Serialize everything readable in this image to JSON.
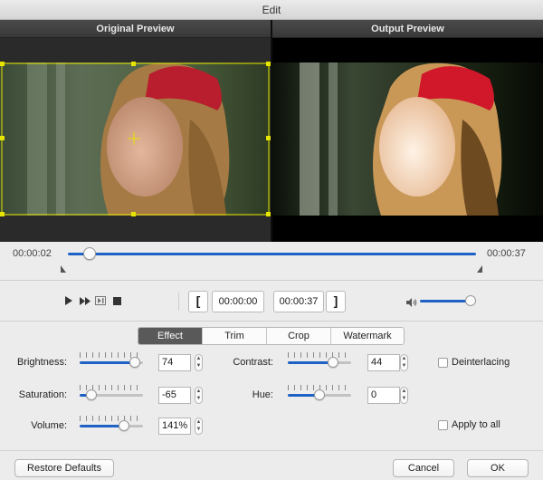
{
  "window": {
    "title": "Edit"
  },
  "preview": {
    "original_title": "Original Preview",
    "output_title": "Output Preview"
  },
  "timeline": {
    "current_time": "00:00:02",
    "end_time": "00:00:37",
    "position_fraction": 0.054
  },
  "playback": {
    "start_time": "00:00:00",
    "end_time": "00:00:37",
    "set_start_label": "[",
    "set_end_label": "]",
    "volume_fraction": 0.9
  },
  "tabs": [
    {
      "label": "Effect",
      "active": true
    },
    {
      "label": "Trim",
      "active": false
    },
    {
      "label": "Crop",
      "active": false
    },
    {
      "label": "Watermark",
      "active": false
    }
  ],
  "effect": {
    "brightness": {
      "label": "Brightness:",
      "value": "74",
      "fraction": 0.87
    },
    "contrast": {
      "label": "Contrast:",
      "value": "44",
      "fraction": 0.72
    },
    "saturation": {
      "label": "Saturation:",
      "value": "-65",
      "fraction": 0.18
    },
    "hue": {
      "label": "Hue:",
      "value": "0",
      "fraction": 0.5
    },
    "volume": {
      "label": "Volume:",
      "value": "141%",
      "fraction": 0.7
    },
    "deinterlacing": {
      "label": "Deinterlacing",
      "checked": false
    },
    "apply_to_all": {
      "label": "Apply to all",
      "checked": false
    }
  },
  "footer": {
    "restore_label": "Restore Defaults",
    "cancel_label": "Cancel",
    "ok_label": "OK"
  },
  "colors": {
    "accent": "#1f62c6",
    "crop_frame": "#e5e500",
    "active_tab": "#595959"
  }
}
